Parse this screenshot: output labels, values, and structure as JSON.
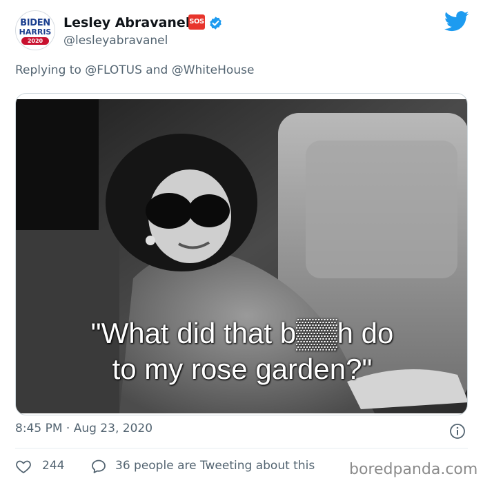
{
  "author": {
    "avatar": {
      "line1": "BIDEN",
      "line2": "HARRIS",
      "line3": "2020"
    },
    "name": "Lesley Abravanel",
    "badge": "SOS",
    "handle": "@lesleyabravanel"
  },
  "reply": {
    "prefix": "Replying to ",
    "to1": "@FLOTUS",
    "joiner": " and ",
    "to2": "@WhiteHouse"
  },
  "media": {
    "caption_line1": "\"What did that b▒▒h do",
    "caption_line2": "to my rose garden?\""
  },
  "meta": {
    "timestamp": "8:45 PM · Aug 23, 2020"
  },
  "actions": {
    "likes": "244",
    "tweeting": "36 people are Tweeting about this"
  },
  "watermark": "boredpanda.com",
  "colors": {
    "twitter_blue": "#1d9bf0",
    "verified": "#1d9bf0",
    "sos_red": "#e8352c",
    "muted": "#536471"
  },
  "icons": [
    "avatar-logo",
    "sos-badge",
    "verified-icon",
    "twitter-bird-icon",
    "info-icon",
    "heart-icon",
    "reply-bubble-icon"
  ]
}
